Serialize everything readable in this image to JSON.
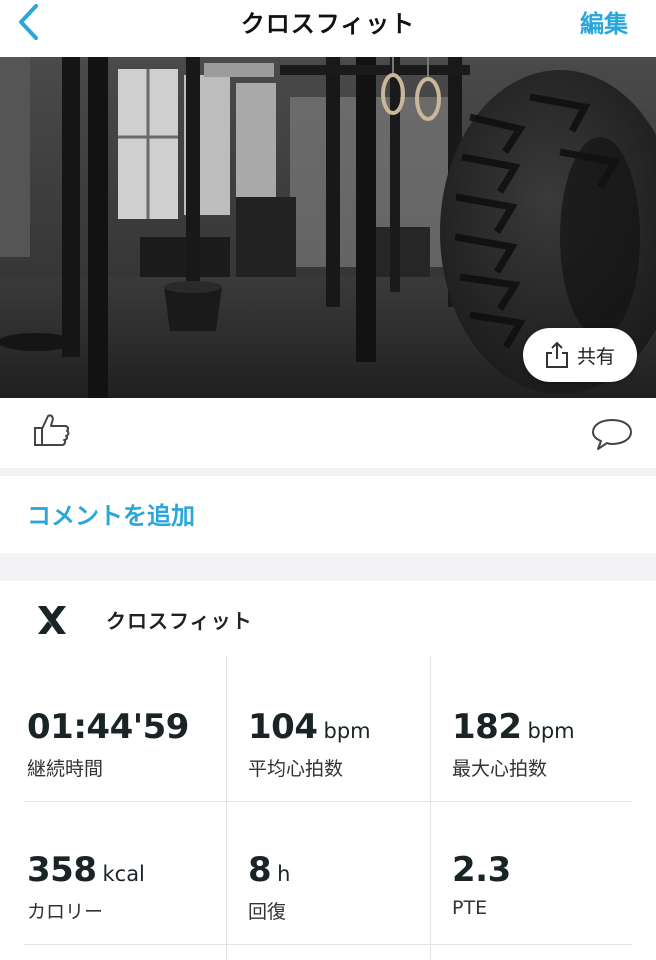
{
  "nav": {
    "title": "クロスフィット",
    "edit_label": "編集",
    "back_icon": "chevron-left-icon"
  },
  "hero": {
    "image": "gym-photo",
    "share_label": "共有",
    "share_icon": "share-icon"
  },
  "actions": {
    "like_icon": "thumbs-up-icon",
    "comment_icon": "speech-bubble-icon"
  },
  "comment": {
    "add_label": "コメントを追加"
  },
  "activity": {
    "icon": "crossfit-icon",
    "name": "クロスフィット"
  },
  "stats": [
    {
      "value": "01:44'59",
      "unit": "",
      "label": "継続時間"
    },
    {
      "value": "104",
      "unit": "bpm",
      "label": "平均心拍数"
    },
    {
      "value": "182",
      "unit": "bpm",
      "label": "最大心拍数"
    },
    {
      "value": "358",
      "unit": "kcal",
      "label": "カロリー"
    },
    {
      "value": "8",
      "unit": "h",
      "label": "回復"
    },
    {
      "value": "2.3",
      "unit": "",
      "label": "PTE"
    }
  ],
  "colors": {
    "accent": "#2aa6d8",
    "text": "#1a2426",
    "separator": "#f3f3f6"
  }
}
